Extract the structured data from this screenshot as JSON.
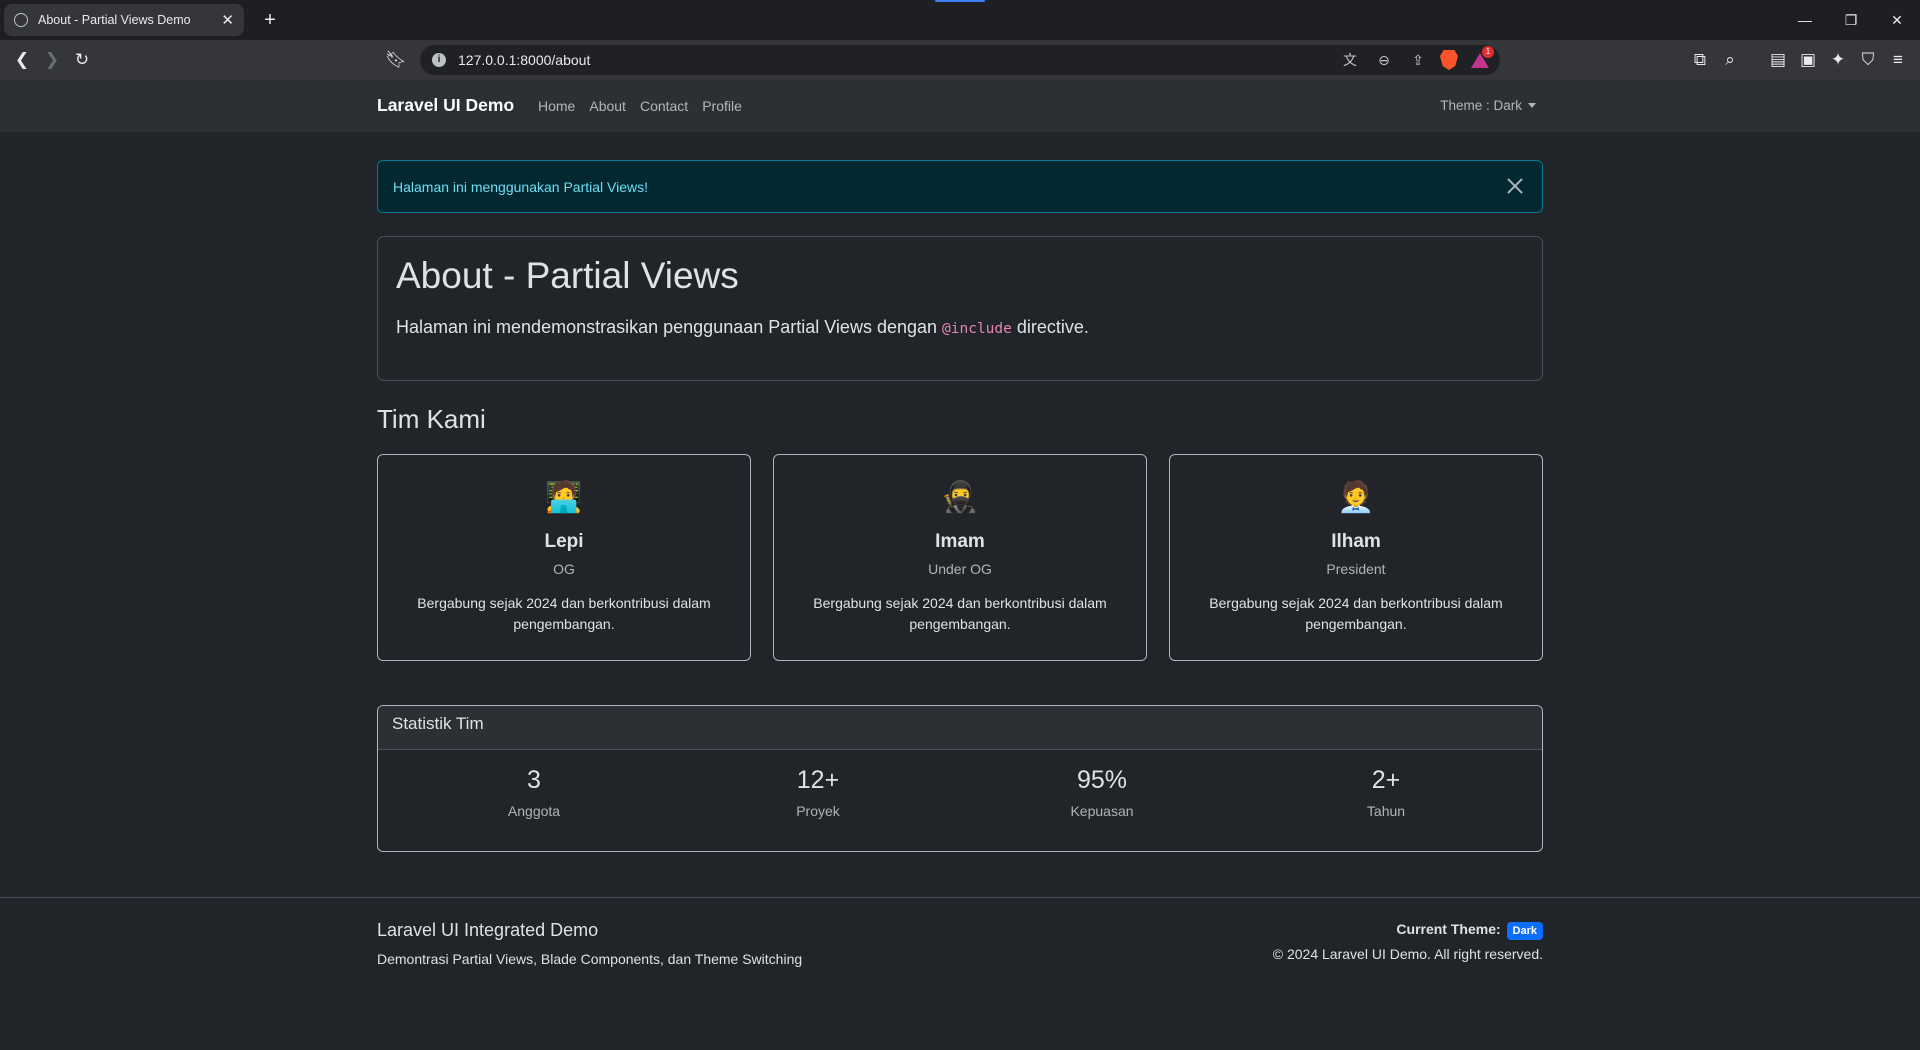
{
  "browser": {
    "tab_title": "About - Partial Views Demo",
    "url": "127.0.0.1:8000/about"
  },
  "navbar": {
    "brand": "Laravel UI Demo",
    "links": [
      "Home",
      "About",
      "Contact",
      "Profile"
    ],
    "theme_dropdown": "Theme : Dark"
  },
  "alert": {
    "message": "Halaman ini menggunakan Partial Views!"
  },
  "hero": {
    "title": "About - Partial Views",
    "text_before": "Halaman ini mendemonstrasikan penggunaan ",
    "text_strong": "Partial Views",
    "text_middle": " dengan ",
    "text_code": "@include",
    "text_after": " directive."
  },
  "team": {
    "title": "Tim Kami",
    "members": [
      {
        "icon": "technologist-emoji",
        "emoji": "🧑‍💻",
        "name": "Lepi",
        "role": "OG",
        "description": "Bergabung sejak 2024 dan berkontribusi dalam pengembangan."
      },
      {
        "icon": "ninja-emoji",
        "emoji": "🥷",
        "name": "Imam",
        "role": "Under OG",
        "description": "Bergabung sejak 2024 dan berkontribusi dalam pengembangan."
      },
      {
        "icon": "office-worker-emoji",
        "emoji": "🧑‍💼",
        "name": "Ilham",
        "role": "President",
        "description": "Bergabung sejak 2024 dan berkontribusi dalam pengembangan."
      }
    ]
  },
  "stats": {
    "title": "Statistik Tim",
    "items": [
      {
        "value": "3",
        "label": "Anggota"
      },
      {
        "value": "12+",
        "label": "Proyek"
      },
      {
        "value": "95%",
        "label": "Kepuasan"
      },
      {
        "value": "2+",
        "label": "Tahun"
      }
    ]
  },
  "footer": {
    "title": "Laravel UI Integrated Demo",
    "subtitle": "Demontrasi Partial Views, Blade Components, dan Theme Switching",
    "theme_label": "Current Theme:",
    "theme_badge": "Dark",
    "copyright": "© 2024 Laravel UI Demo. All right reserved."
  },
  "colors": {
    "background": "#212529",
    "navbar": "#2b3035",
    "alert_bg": "#032830",
    "alert_text": "#6edff6",
    "badge": "#0d6efd",
    "code": "#e685b5"
  }
}
